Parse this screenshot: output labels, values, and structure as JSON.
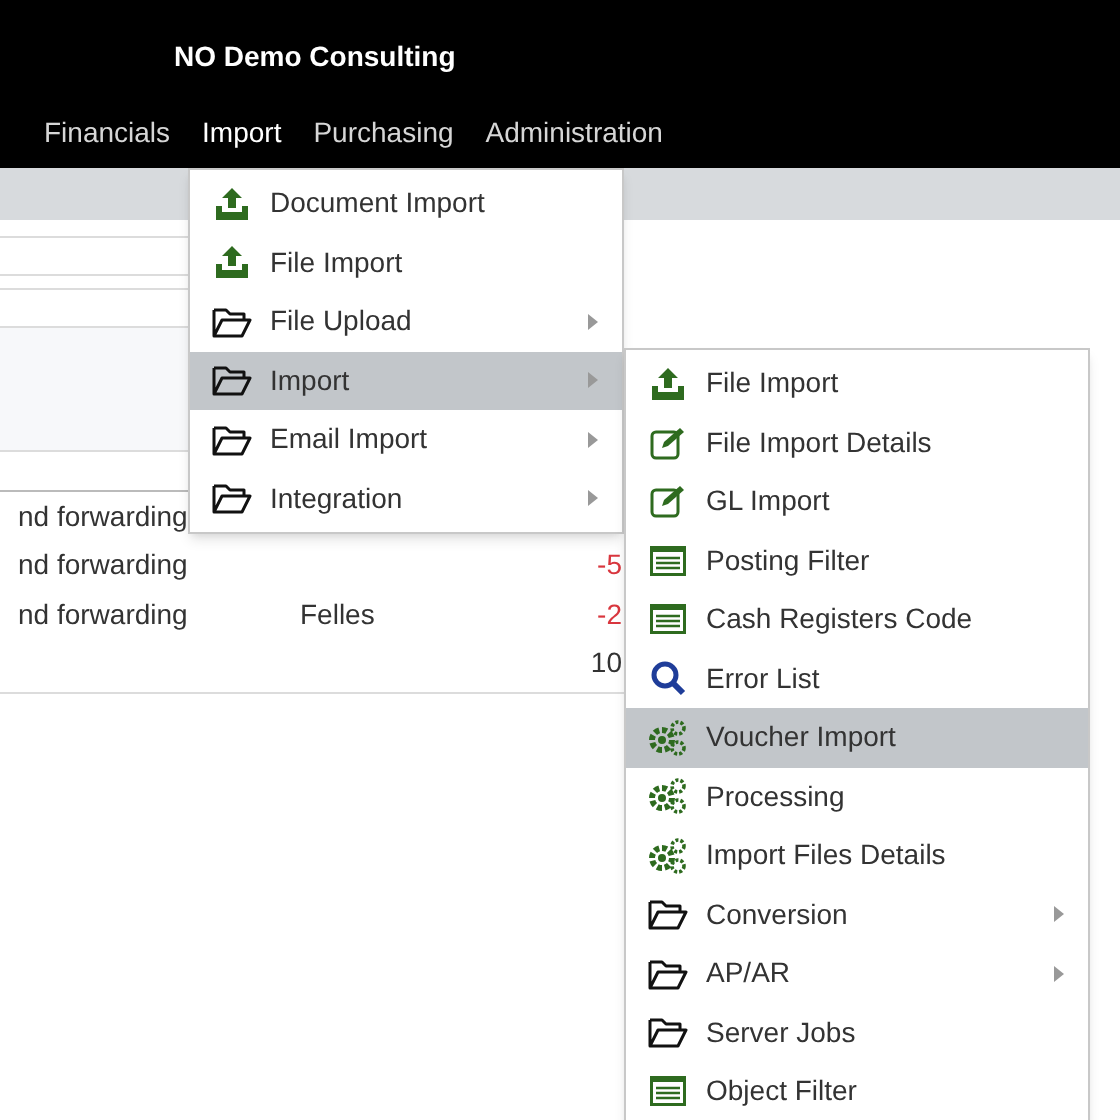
{
  "header": {
    "title": "NO Demo Consulting"
  },
  "menu_bar": [
    {
      "label": "Financials",
      "selected": false
    },
    {
      "label": "Import",
      "selected": true
    },
    {
      "label": "Purchasing",
      "selected": false
    },
    {
      "label": "Administration",
      "selected": false
    }
  ],
  "table": {
    "rows": [
      {
        "column_1": "nd forwarding"
      },
      {
        "column_1": "nd forwarding",
        "column_3": "-5",
        "negative": true
      },
      {
        "column_1": "nd forwarding",
        "column_2": "Felles",
        "column_3": "-2",
        "negative": true
      },
      {
        "column_3": "10",
        "negative": false
      }
    ]
  },
  "import_menu": [
    {
      "label": "Document Import",
      "kind": "upload",
      "submenu": false,
      "selected": false
    },
    {
      "label": "File Import",
      "kind": "upload",
      "submenu": false,
      "selected": false
    },
    {
      "label": "File Upload",
      "kind": "folder",
      "submenu": true,
      "selected": false
    },
    {
      "label": "Import",
      "kind": "folder",
      "submenu": true,
      "selected": true
    },
    {
      "label": "Email Import",
      "kind": "folder",
      "submenu": true,
      "selected": false
    },
    {
      "label": "Integration",
      "kind": "folder",
      "submenu": true,
      "selected": false
    }
  ],
  "import_submenu": [
    {
      "label": "File Import",
      "kind": "upload",
      "submenu": false,
      "selected": false
    },
    {
      "label": "File Import Details",
      "kind": "edit",
      "submenu": false,
      "selected": false
    },
    {
      "label": "GL Import",
      "kind": "edit",
      "submenu": false,
      "selected": false
    },
    {
      "label": "Posting Filter",
      "kind": "list",
      "submenu": false,
      "selected": false
    },
    {
      "label": "Cash Registers Code",
      "kind": "list",
      "submenu": false,
      "selected": false
    },
    {
      "label": "Error List",
      "kind": "search",
      "submenu": false,
      "selected": false
    },
    {
      "label": "Voucher Import",
      "kind": "gears",
      "submenu": false,
      "selected": true
    },
    {
      "label": "Processing",
      "kind": "gears",
      "submenu": false,
      "selected": false
    },
    {
      "label": "Import Files Details",
      "kind": "gears",
      "submenu": false,
      "selected": false
    },
    {
      "label": "Conversion",
      "kind": "folder",
      "submenu": true,
      "selected": false
    },
    {
      "label": "AP/AR",
      "kind": "folder",
      "submenu": true,
      "selected": false
    },
    {
      "label": "Server Jobs",
      "kind": "folder",
      "submenu": false,
      "selected": false
    },
    {
      "label": "Object Filter",
      "kind": "list",
      "submenu": false,
      "selected": false
    }
  ]
}
